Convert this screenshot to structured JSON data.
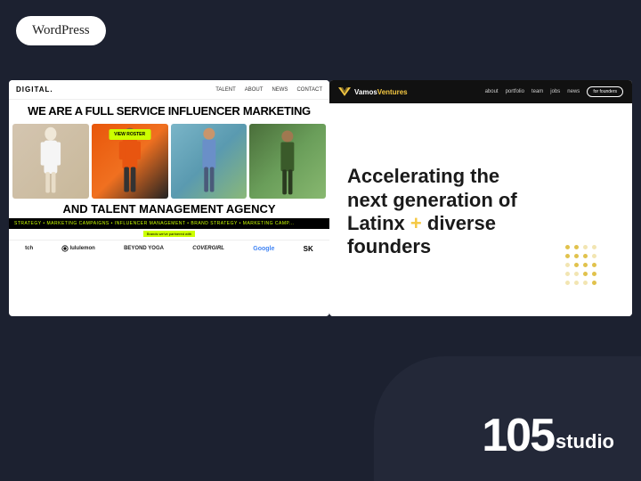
{
  "badge": {
    "label": "WordPress"
  },
  "leftPanel": {
    "nav": {
      "logo": "DIGITAL.",
      "links": [
        "TALENT",
        "ABOUT",
        "NEWS",
        "CONTACT"
      ]
    },
    "hero": {
      "title": "WE ARE A FULL SERVICE INFLUENCER MARKETING",
      "subtitle": "AND TALENT\nMANAGEMENT AGENCY",
      "viewRoster": "VIEW ROSTER"
    },
    "ticker": "STRATEGY • MARKETING CAMPAIGNS • INFLUENCER MANAGEMENT • BRAND STRATEGY • MARKETING CAMP...",
    "partners": {
      "highlight": "Brands we've partnered with"
    },
    "brands": [
      "tch",
      "lululemon",
      "BEYOND YOGA",
      "COVERGIRL",
      "Google",
      "SK"
    ]
  },
  "rightPanel": {
    "nav": {
      "logoVamos": "Vamos",
      "logoVentures": "Ventures",
      "links": [
        "about",
        "portfolio",
        "team",
        "jobs",
        "news"
      ],
      "foundersBtn": "for founders"
    },
    "hero": {
      "line1": "Accelerating the",
      "line2": "next generation of",
      "line3Start": "Latinx",
      "plus": "+",
      "line3End": "diverse",
      "line4": "founders"
    }
  },
  "bottomLogo": {
    "number": "105",
    "studio": "studio"
  }
}
